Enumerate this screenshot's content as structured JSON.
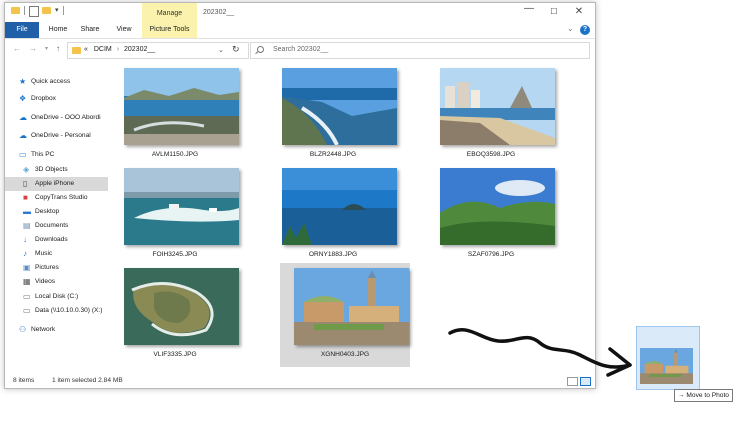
{
  "titlebar": {
    "manage_tab": "Manage",
    "folder_title": "202302__",
    "min_glyph": "—",
    "max_glyph": "☐",
    "close_glyph": "✕"
  },
  "ribbon": {
    "tabs": [
      "File",
      "Home",
      "Share",
      "View",
      "Picture Tools"
    ],
    "help": "?"
  },
  "address": {
    "prefix": "«",
    "crumbs": [
      "DCIM",
      "202302__"
    ],
    "separator": "›",
    "search_placeholder": "Search 202302__"
  },
  "sidebar": {
    "items": [
      {
        "label": "Quick access",
        "icon": "star-icon",
        "color": "#1a73c9"
      },
      {
        "label": "Dropbox",
        "icon": "dropbox-icon",
        "color": "#1a73c9"
      },
      {
        "label": "OneDrive - OOO Abordi",
        "icon": "cloud-icon",
        "color": "#1a73c9"
      },
      {
        "label": "OneDrive - Personal",
        "icon": "cloud-icon",
        "color": "#1a73c9"
      },
      {
        "label": "This PC",
        "icon": "computer-icon",
        "color": "#3b8fd6"
      },
      {
        "label": "3D Objects",
        "icon": "cube-icon",
        "color": "#57a0d8"
      },
      {
        "label": "Apple iPhone",
        "icon": "phone-icon",
        "color": "#444444"
      },
      {
        "label": "CopyTrans Studio",
        "icon": "app-icon",
        "color": "#d94040"
      },
      {
        "label": "Desktop",
        "icon": "desktop-icon",
        "color": "#2a7bd0"
      },
      {
        "label": "Documents",
        "icon": "document-icon",
        "color": "#6a8bb0"
      },
      {
        "label": "Downloads",
        "icon": "download-icon",
        "color": "#2a7bd0"
      },
      {
        "label": "Music",
        "icon": "music-icon",
        "color": "#2a7bd0"
      },
      {
        "label": "Pictures",
        "icon": "picture-icon",
        "color": "#5b8fc4"
      },
      {
        "label": "Videos",
        "icon": "video-icon",
        "color": "#555555"
      },
      {
        "label": "Local Disk (C:)",
        "icon": "disk-icon",
        "color": "#777777"
      },
      {
        "label": "Data (\\\\10.10.0.30) (X:)",
        "icon": "network-drive-icon",
        "color": "#777777"
      },
      {
        "label": "Network",
        "icon": "network-icon",
        "color": "#2a7bd0"
      }
    ],
    "selected": "Apple iPhone"
  },
  "files": [
    {
      "name": "AVLM1150.JPG",
      "scene": "harbor",
      "selected": false
    },
    {
      "name": "BLZR2448.JPG",
      "scene": "coast",
      "selected": false
    },
    {
      "name": "EBOQ3598.JPG",
      "scene": "beachtown",
      "selected": false
    },
    {
      "name": "FOIH3245.JPG",
      "scene": "boats",
      "selected": false
    },
    {
      "name": "ORNY1883.JPG",
      "scene": "island",
      "selected": false
    },
    {
      "name": "SZAF0796.JPG",
      "scene": "hills",
      "selected": false
    },
    {
      "name": "VLIF3335.JPG",
      "scene": "aerial",
      "selected": false
    },
    {
      "name": "XGNH0403.JPG",
      "scene": "park",
      "selected": true
    }
  ],
  "status": {
    "count": "8 items",
    "selection": "1 item selected  2.84 MB"
  },
  "drag": {
    "tooltip": "→ Move to Photo"
  }
}
